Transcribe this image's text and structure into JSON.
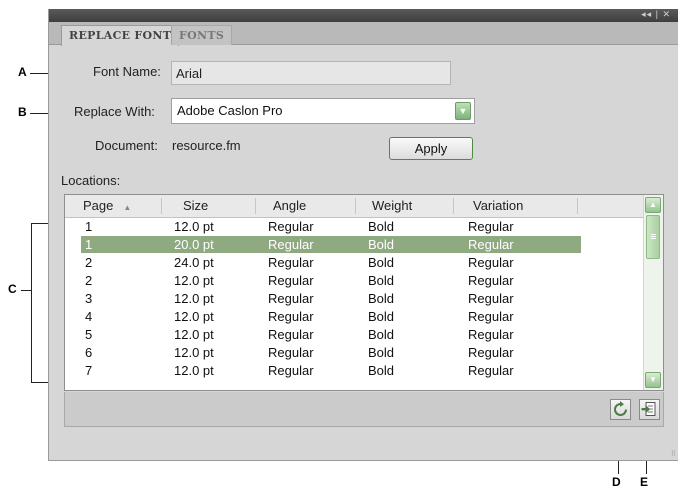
{
  "tabs": {
    "active": "REPLACE FONT",
    "inactive": "FONTS"
  },
  "fields": {
    "font_name_label": "Font Name:",
    "font_name_value": "Arial",
    "replace_with_label": "Replace With:",
    "replace_with_value": "Adobe Caslon Pro",
    "document_label": "Document:",
    "document_value": "resource.fm",
    "apply_label": "Apply",
    "locations_label": "Locations:"
  },
  "table": {
    "headers": [
      "Page",
      "Size",
      "Angle",
      "Weight",
      "Variation"
    ],
    "selected_row": 1,
    "rows": [
      {
        "page": "1",
        "size": "12.0 pt",
        "angle": "Regular",
        "weight": "Bold",
        "variation": "Regular"
      },
      {
        "page": "1",
        "size": "20.0 pt",
        "angle": "Regular",
        "weight": "Bold",
        "variation": "Regular"
      },
      {
        "page": "2",
        "size": "24.0 pt",
        "angle": "Regular",
        "weight": "Bold",
        "variation": "Regular"
      },
      {
        "page": "2",
        "size": "12.0 pt",
        "angle": "Regular",
        "weight": "Bold",
        "variation": "Regular"
      },
      {
        "page": "3",
        "size": "12.0 pt",
        "angle": "Regular",
        "weight": "Bold",
        "variation": "Regular"
      },
      {
        "page": "4",
        "size": "12.0 pt",
        "angle": "Regular",
        "weight": "Bold",
        "variation": "Regular"
      },
      {
        "page": "5",
        "size": "12.0 pt",
        "angle": "Regular",
        "weight": "Bold",
        "variation": "Regular"
      },
      {
        "page": "6",
        "size": "12.0 pt",
        "angle": "Regular",
        "weight": "Bold",
        "variation": "Regular"
      },
      {
        "page": "7",
        "size": "12.0 pt",
        "angle": "Regular",
        "weight": "Bold",
        "variation": "Regular"
      }
    ]
  },
  "callouts": {
    "a": "A",
    "b": "B",
    "c": "C",
    "d": "D",
    "e": "E"
  },
  "icons": {
    "refresh": "refresh-icon",
    "go_to_page": "go-to-location-icon"
  },
  "colors": {
    "accent_green": "#8faa80",
    "selection": "#8faa80"
  }
}
